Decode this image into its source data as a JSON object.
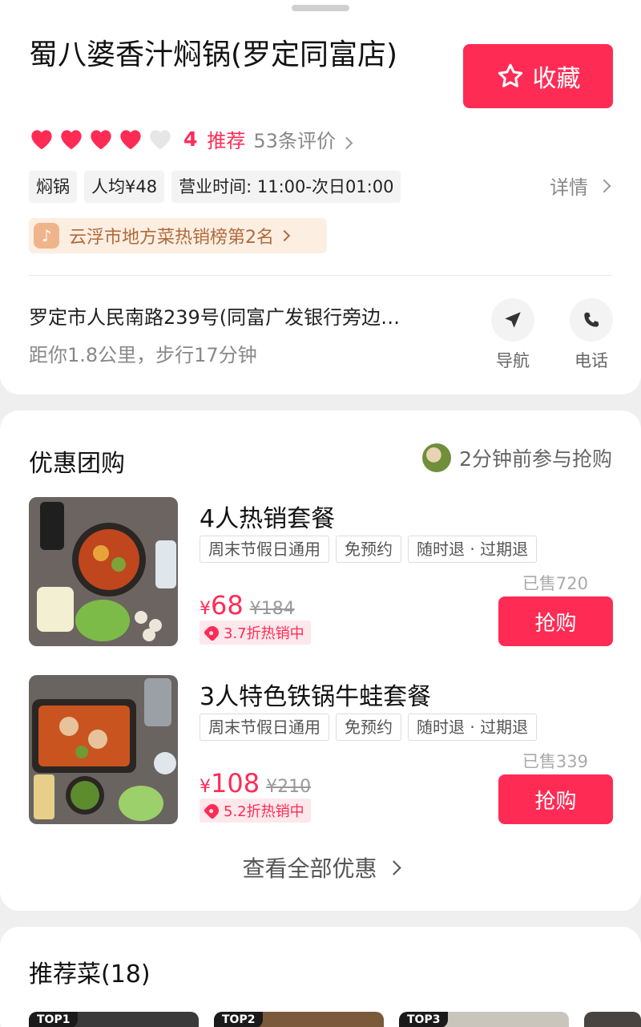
{
  "shop": {
    "name": "蜀八婆香汁焖锅(罗定同富店)",
    "favorite_label": "收藏",
    "hearts_filled": 4,
    "hearts_total": 5,
    "score": "4",
    "recommend": "推荐",
    "reviews": "53条评价",
    "tags": [
      "焖锅",
      "人均¥48",
      "营业时间: 11:00-次日01:00"
    ],
    "details_label": "详情",
    "rank_text": "云浮市地方菜热销榜第2名",
    "address": "罗定市人民南路239号(同富广发银行旁边…",
    "distance": "距你1.8公里，步行17分钟",
    "nav_label": "导航",
    "phone_label": "电话"
  },
  "deals_section": {
    "title": "优惠团购",
    "participate": "2分钟前参与抢购",
    "view_all": "查看全部优惠",
    "items": [
      {
        "title": "4人热销套餐",
        "tags": [
          "周末节假日通用",
          "免预约",
          "随时退 · 过期退"
        ],
        "sold": "已售720",
        "currency": "¥",
        "price": "68",
        "old_price": "¥184",
        "promo": "3.7折热销中",
        "buy_label": "抢购"
      },
      {
        "title": "3人特色铁锅牛蛙套餐",
        "tags": [
          "周末节假日通用",
          "免预约",
          "随时退 · 过期退"
        ],
        "sold": "已售339",
        "currency": "¥",
        "price": "108",
        "old_price": "¥210",
        "promo": "5.2折热销中",
        "buy_label": "抢购"
      }
    ]
  },
  "dishes_section": {
    "title": "推荐菜(18)",
    "badges": [
      "TOP1",
      "TOP2",
      "TOP3"
    ]
  },
  "colors": {
    "accent": "#fe2c55",
    "rank_bg": "#fdeee2",
    "rank_text": "#b06a3b"
  }
}
